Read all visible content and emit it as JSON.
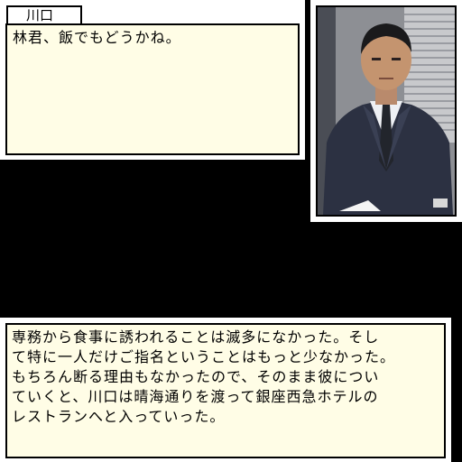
{
  "dialog": {
    "speaker": "川口",
    "text": "林君、飯でもどうかね。"
  },
  "portrait": {
    "character": "川口",
    "icon": "character-portrait"
  },
  "narration": {
    "lines": [
      "専務から食事に誘われることは滅多になかった。そし",
      "て特に一人だけご指名ということはもっと少なかった。",
      "もちろん断る理由もなかったので、そのまま彼につい",
      "ていくと、川口は晴海通りを渡って銀座西急ホテルの",
      "レストランへと入っていった。"
    ]
  },
  "colors": {
    "background": "#000000",
    "window_fill": "#fffde6",
    "window_border": "#ffffff",
    "text": "#000000"
  }
}
